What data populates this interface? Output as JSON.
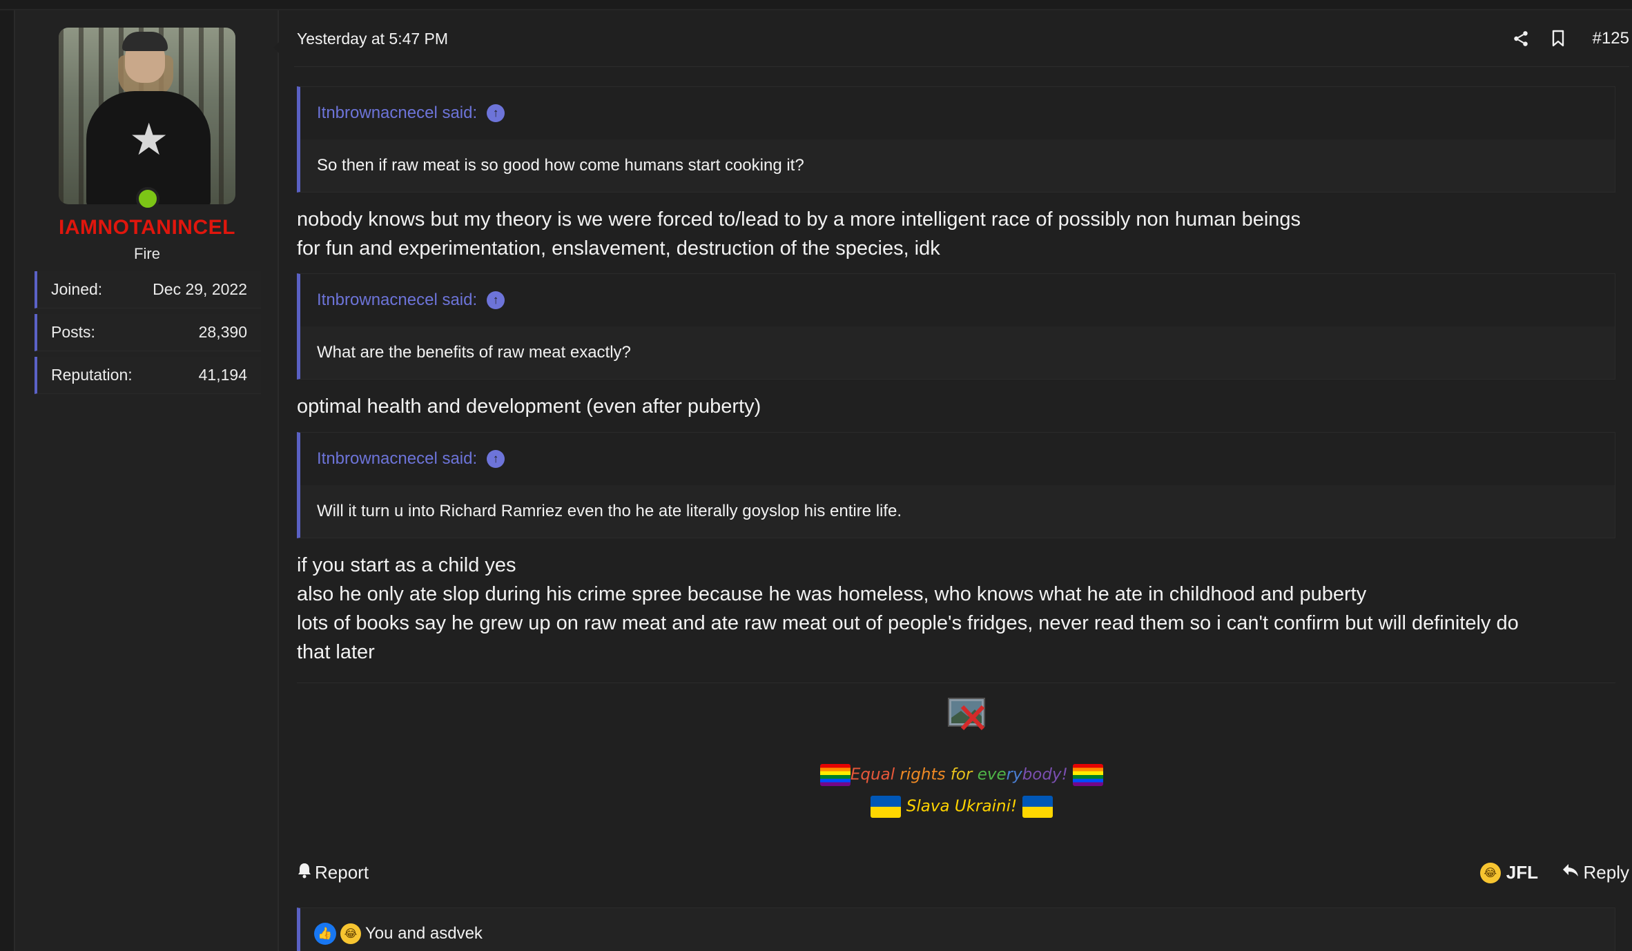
{
  "user": {
    "username": "IAMNOTANINCEL",
    "title": "Fire",
    "stats": [
      {
        "label": "Joined:",
        "value": "Dec 29, 2022"
      },
      {
        "label": "Posts:",
        "value": "28,390"
      },
      {
        "label": "Reputation:",
        "value": "41,194"
      }
    ]
  },
  "post": {
    "timestamp": "Yesterday at 5:47 PM",
    "number": "#125",
    "icons": {
      "share": "share-icon",
      "bookmark": "bookmark-icon"
    },
    "quotes": [
      {
        "author": "Itnbrownacnecel said:",
        "text": "So then if raw meat is so good how come humans start cooking it?"
      },
      {
        "author": "Itnbrownacnecel said:",
        "text": "What are the benefits of raw meat exactly?"
      },
      {
        "author": "Itnbrownacnecel said:",
        "text": "Will it turn u into Richard Ramriez even tho he ate literally goyslop his entire life."
      }
    ],
    "replies": [
      [
        "nobody knows but my theory is we were forced to/lead to by a more intelligent race of possibly non human beings",
        "for fun and experimentation, enslavement, destruction of the species, idk"
      ],
      [
        "optimal health and development (even after puberty)"
      ],
      [
        "if you start as a child yes",
        "also he only ate slop during his crime spree because he was homeless, who knows what he ate in childhood and puberty",
        "lots of books say he grew up on raw meat and ate raw meat out of people's fridges, never read them so i can't confirm but will definitely do",
        "that later"
      ]
    ]
  },
  "signature": {
    "line1_words": [
      {
        "text": "Equal ",
        "color": "#e8583a"
      },
      {
        "text": "rights ",
        "color": "#f08a24"
      },
      {
        "text": "for ",
        "color": "#e8c21c"
      },
      {
        "text": "eve",
        "color": "#4fb548"
      },
      {
        "text": "ry",
        "color": "#4a7fd4"
      },
      {
        "text": "body!",
        "color": "#7a4fb0"
      }
    ],
    "line2": "Slava Ukraini!",
    "line2_color": "#ffd400"
  },
  "actions": {
    "report": "Report",
    "jfl": "JFL",
    "reply": "Reply"
  },
  "reactions": {
    "text": "You and asdvek"
  },
  "colors": {
    "accent": "#5a61c4",
    "username": "#e0160d",
    "online": "#7cc516",
    "quote_link": "#6d74d9"
  }
}
